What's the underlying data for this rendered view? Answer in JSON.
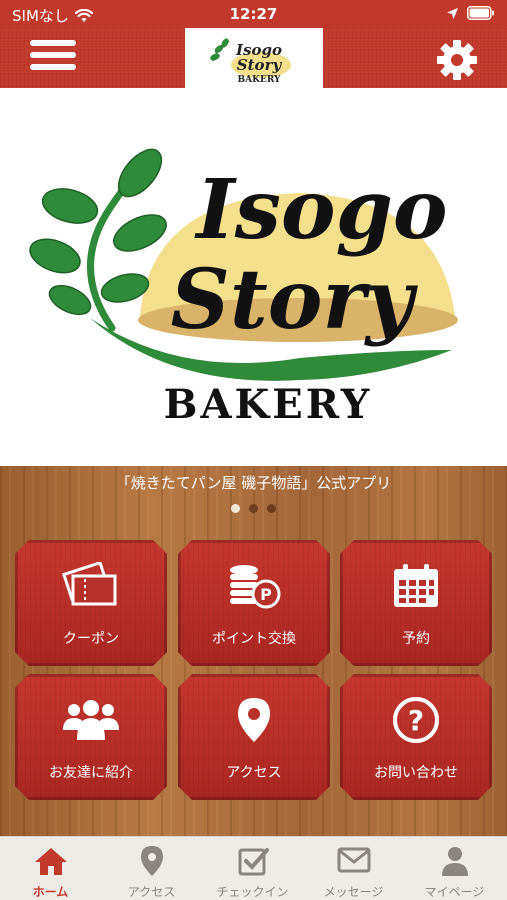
{
  "status_bar": {
    "carrier": "SIMなし",
    "time": "12:27"
  },
  "header": {
    "logo_line1": "Isogo",
    "logo_line2": "Story",
    "logo_line3": "BAKERY"
  },
  "hero": {
    "logo_line1": "Isogo",
    "logo_line2": "Story",
    "logo_line3": "BAKERY"
  },
  "banner": {
    "tagline": "「焼きたてパン屋 磯子物語」公式アプリ",
    "slides": 3,
    "active_slide": 1
  },
  "tiles": [
    {
      "label": "クーポン",
      "icon": "ticket-icon"
    },
    {
      "label": "ポイント交換",
      "icon": "coins-icon"
    },
    {
      "label": "予約",
      "icon": "calendar-icon"
    },
    {
      "label": "お友達に紹介",
      "icon": "people-icon"
    },
    {
      "label": "アクセス",
      "icon": "map-pin-icon"
    },
    {
      "label": "お問い合わせ",
      "icon": "question-icon"
    }
  ],
  "tabbar": [
    {
      "label": "ホーム",
      "icon": "home-icon",
      "active": true
    },
    {
      "label": "アクセス",
      "icon": "map-pin-icon",
      "active": false
    },
    {
      "label": "チェックイン",
      "icon": "checkin-icon",
      "active": false
    },
    {
      "label": "メッセージ",
      "icon": "mail-icon",
      "active": false
    },
    {
      "label": "マイページ",
      "icon": "user-icon",
      "active": false
    }
  ],
  "colors": {
    "brand_red": "#c23a2b",
    "tab_active": "#c23a2b",
    "leaf_green": "#2f8a3a",
    "bread_yellow": "#f3df8c"
  }
}
